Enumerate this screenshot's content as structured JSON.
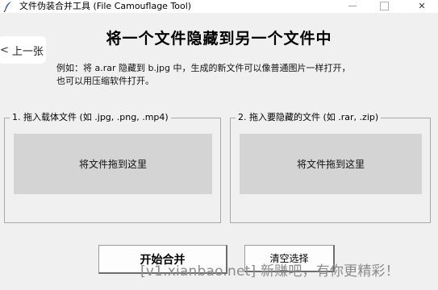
{
  "window": {
    "title": "文件伪装合并工具 (File Camouflage Tool)",
    "close_glyph": "✕"
  },
  "nav": {
    "prev_label": "上一张",
    "prev_glyph": "<"
  },
  "main": {
    "heading": "将一个文件隐藏到另一个文件中",
    "desc_line1": "例如：将 a.rar 隐藏到 b.jpg 中，生成的新文件可以像普通图片一样打开，",
    "desc_line2": "也可以用压缩软件打开。"
  },
  "carrier": {
    "legend": "1. 拖入载体文件 (如 .jpg, .png, .mp4)",
    "drop_text": "将文件拖到这里"
  },
  "hidden": {
    "legend": "2. 拖入要隐藏的文件 (如 .rar, .zip)",
    "drop_text": "将文件拖到这里"
  },
  "actions": {
    "merge_label": "开始合并",
    "clear_label": "清空选择"
  },
  "watermark": "[v1.xianbao.net] 新赚吧，有你更精彩！"
}
